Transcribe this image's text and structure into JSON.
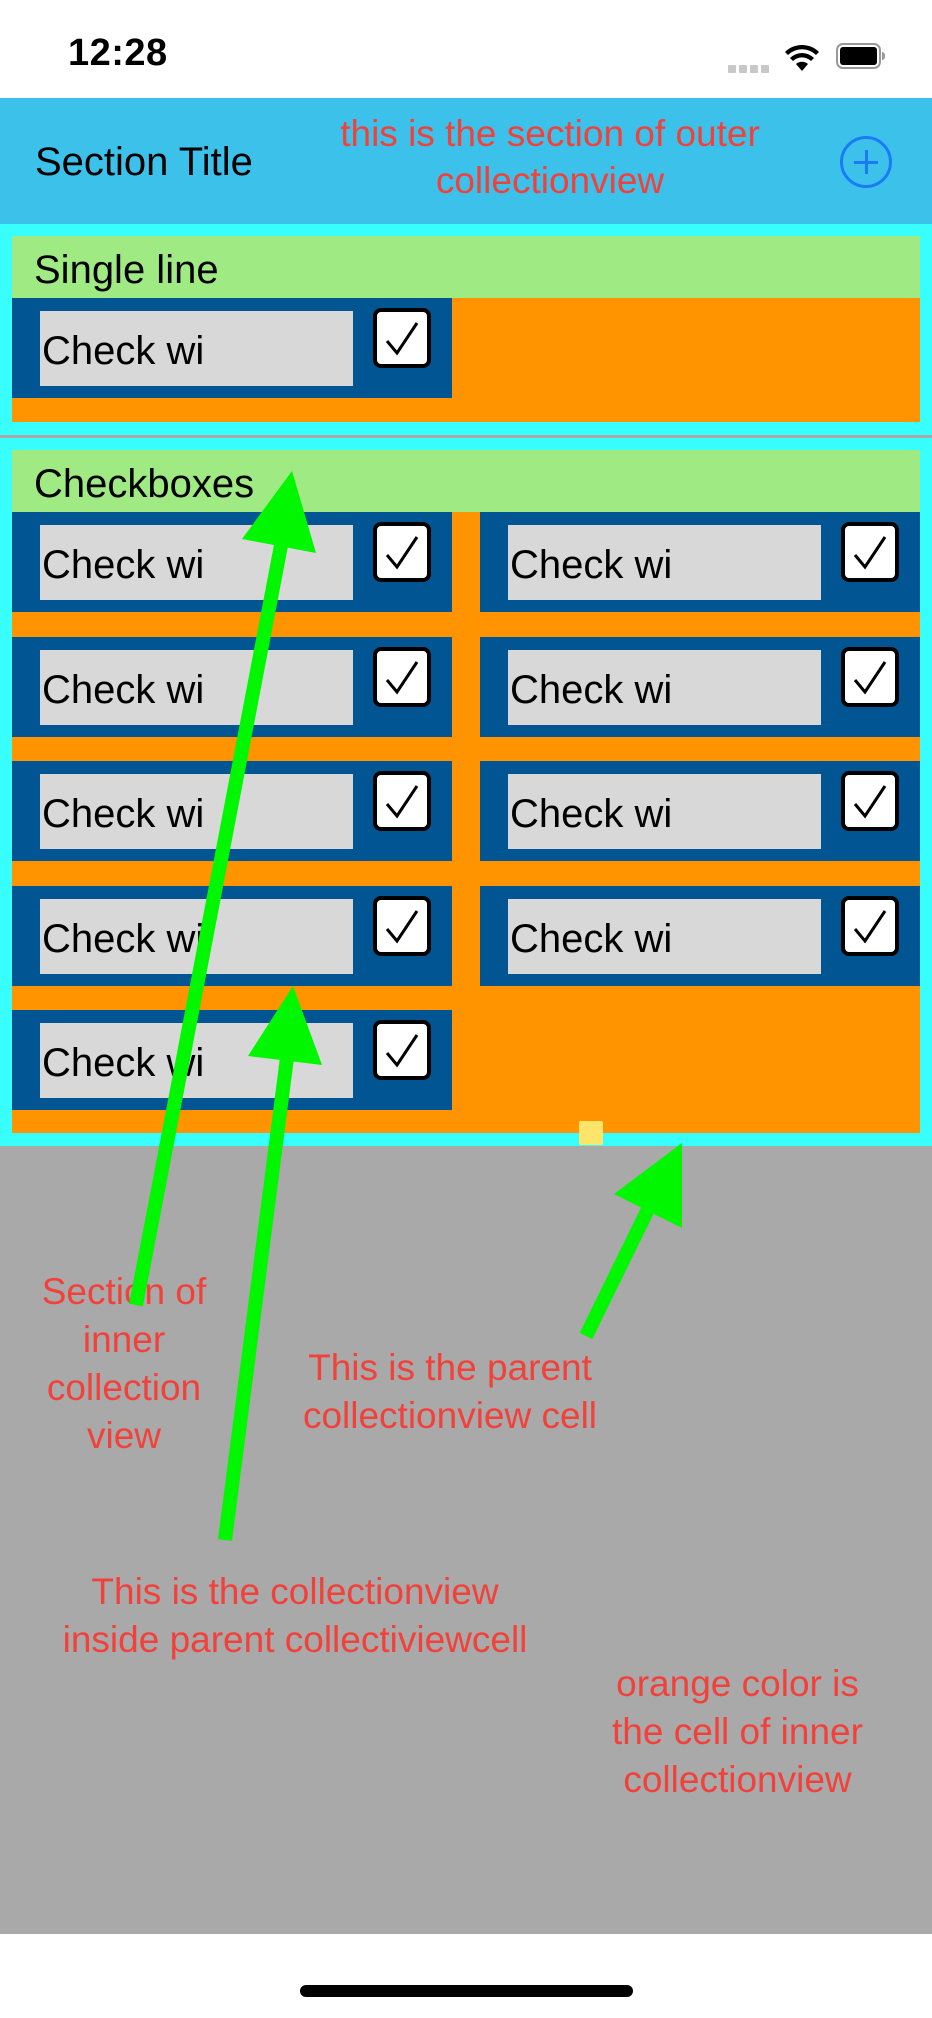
{
  "status_bar": {
    "time": "12:28",
    "signal_icon": "cellular-signal-icon",
    "wifi_icon": "wifi-icon",
    "battery_icon": "battery-icon"
  },
  "outer_section": {
    "title": "Section Title",
    "annotation": "this is the section of outer collectionview",
    "add_button_icon": "plus-circle-icon"
  },
  "inner_sections": [
    {
      "title": "Single line",
      "cells": [
        {
          "label": "Check wi",
          "checked": true
        }
      ]
    },
    {
      "title": "Checkboxes",
      "cells": [
        {
          "label": "Check wi",
          "checked": true
        },
        {
          "label": "Check wi",
          "checked": true
        },
        {
          "label": "Check wi",
          "checked": true
        },
        {
          "label": "Check wi",
          "checked": true
        },
        {
          "label": "Check wi",
          "checked": true
        },
        {
          "label": "Check wi",
          "checked": true
        },
        {
          "label": "Check wi",
          "checked": true
        },
        {
          "label": "Check wi",
          "checked": true
        },
        {
          "label": "Check wi",
          "checked": true
        }
      ]
    }
  ],
  "annotations": {
    "section_of_inner": "Section of inner collection view",
    "parent_cell": "This is the parent collectionview cell",
    "inner_collectionview": "This is the collectionview inside parent collectiviewcell",
    "orange_note": "orange color is the cell of inner collectionview"
  },
  "colors": {
    "outer_header": "#3cc1ea",
    "parent_cell": "#38fefe",
    "inner_header": "#a0ea84",
    "inner_cell_area": "#ff9300",
    "cell": "#005592",
    "label_bg": "#d8d8d8",
    "annotation_text": "#f2413a",
    "arrow": "#00f700",
    "background": "#a9a9a9",
    "accent": "#1a7cf5"
  }
}
